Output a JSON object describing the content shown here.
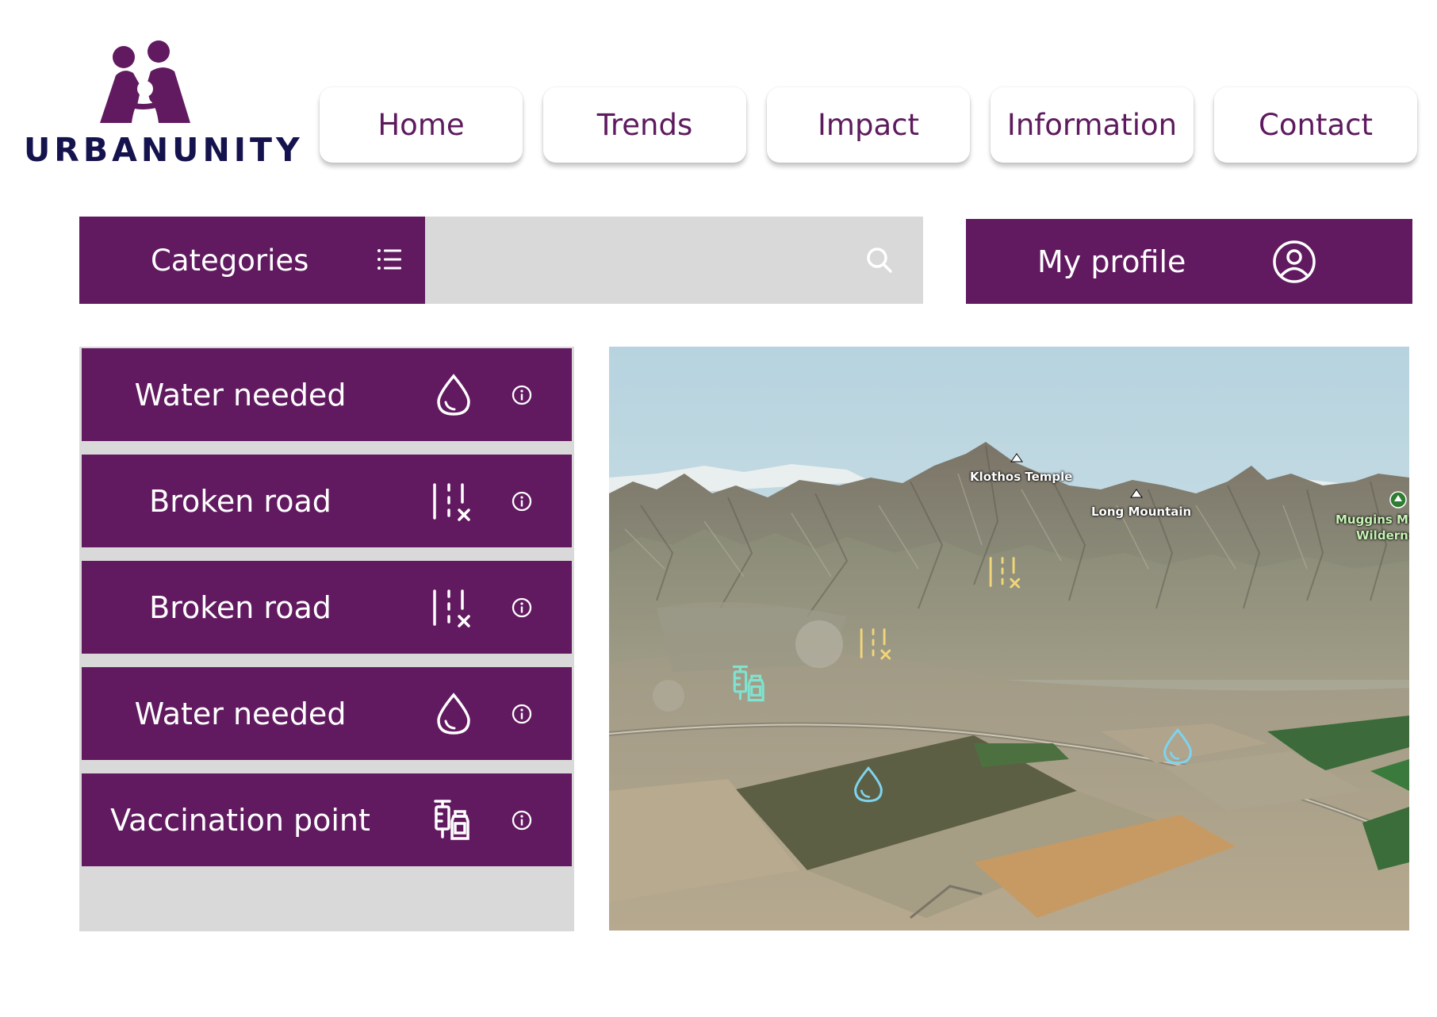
{
  "brand": {
    "name": "URBANUNITY"
  },
  "nav": {
    "items": [
      {
        "label": "Home"
      },
      {
        "label": "Trends"
      },
      {
        "label": "Impact"
      },
      {
        "label": "Information"
      },
      {
        "label": "Contact"
      }
    ]
  },
  "toolbar": {
    "categories_label": "Categories",
    "categories_icon": "list-icon",
    "search_value": "",
    "search_icon": "search-icon",
    "profile_label": "My profile",
    "profile_icon": "user-circle-icon"
  },
  "reports": [
    {
      "label": "Water needed",
      "icon": "water-drop-icon"
    },
    {
      "label": "Broken road",
      "icon": "broken-road-icon"
    },
    {
      "label": "Broken road",
      "icon": "broken-road-icon"
    },
    {
      "label": "Water needed",
      "icon": "water-drop-icon"
    },
    {
      "label": "Vaccination point",
      "icon": "vaccination-icon"
    }
  ],
  "map": {
    "labels": {
      "peak1": "Klothos Temple",
      "peak2": "Long Mountain",
      "park_line1": "Muggins Mo",
      "park_line2": "Wilderne"
    },
    "markers": [
      {
        "type": "broken-road",
        "color": "#f2d57a"
      },
      {
        "type": "broken-road",
        "color": "#f2d57a"
      },
      {
        "type": "vaccination",
        "color": "#7fe3d0"
      },
      {
        "type": "water",
        "color": "#7fd3ee"
      },
      {
        "type": "water",
        "color": "#7fd3ee"
      }
    ]
  },
  "colors": {
    "brand_purple": "#611a60",
    "brand_navy": "#15134d",
    "panel_gray": "#d9d9d9"
  }
}
